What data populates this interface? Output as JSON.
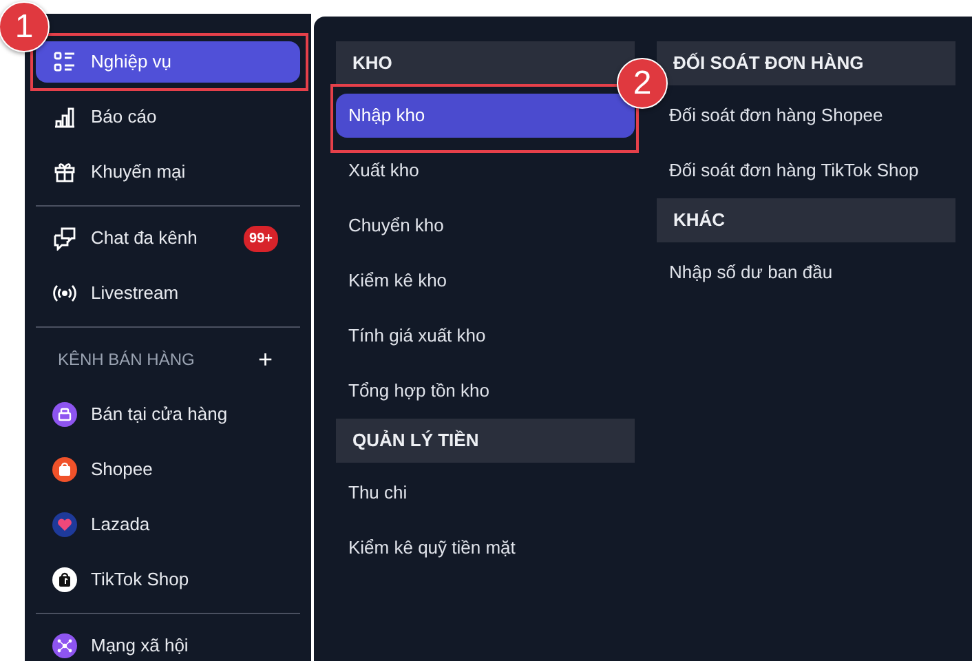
{
  "sidebar": {
    "groups": [
      {
        "items": [
          {
            "label": "Nghiệp vụ",
            "kind": "list",
            "selected": true,
            "callout": "1"
          },
          {
            "label": "Báo cáo",
            "kind": "chart",
            "selected": false
          },
          {
            "label": "Khuyến mại",
            "kind": "gift",
            "selected": false
          }
        ]
      },
      {
        "items": [
          {
            "label": "Chat đa kênh",
            "kind": "chat",
            "selected": false,
            "badge": "99+"
          },
          {
            "label": "Livestream",
            "kind": "broadcast",
            "selected": false
          }
        ]
      },
      {
        "header": {
          "label": "KÊNH BÁN HÀNG",
          "action": "+"
        },
        "items": [
          {
            "label": "Bán tại cửa hàng",
            "kind": "store",
            "selected": false
          },
          {
            "label": "Shopee",
            "kind": "bag",
            "selected": false
          },
          {
            "label": "Lazada",
            "kind": "heart",
            "selected": false
          },
          {
            "label": "TikTok Shop",
            "kind": "darkbag",
            "selected": false
          }
        ]
      },
      {
        "items": [
          {
            "label": "Mạng xã hội",
            "kind": "network",
            "selected": false
          }
        ]
      }
    ]
  },
  "flyout": {
    "columns": [
      {
        "sections": [
          {
            "title": "KHO",
            "items": [
              {
                "label": "Nhập kho",
                "selected": true,
                "callout": "2"
              },
              {
                "label": "Xuất kho",
                "selected": false
              },
              {
                "label": "Chuyển kho",
                "selected": false
              },
              {
                "label": "Kiểm kê kho",
                "selected": false
              },
              {
                "label": "Tính giá xuất kho",
                "selected": false
              },
              {
                "label": "Tổng hợp tồn kho",
                "selected": false
              }
            ]
          },
          {
            "title": "QUẢN LÝ TIỀN",
            "items": [
              {
                "label": "Thu chi",
                "selected": false
              },
              {
                "label": "Kiểm kê quỹ tiền mặt",
                "selected": false
              }
            ]
          }
        ]
      },
      {
        "sections": [
          {
            "title": "ĐỐI SOÁT ĐƠN HÀNG",
            "items": [
              {
                "label": "Đối soát đơn hàng Shopee",
                "selected": false
              },
              {
                "label": "Đối soát đơn hàng TikTok Shop",
                "selected": false
              }
            ]
          },
          {
            "title": "KHÁC",
            "items": [
              {
                "label": "Nhập số dư ban đầu",
                "selected": false
              }
            ]
          }
        ]
      }
    ]
  }
}
